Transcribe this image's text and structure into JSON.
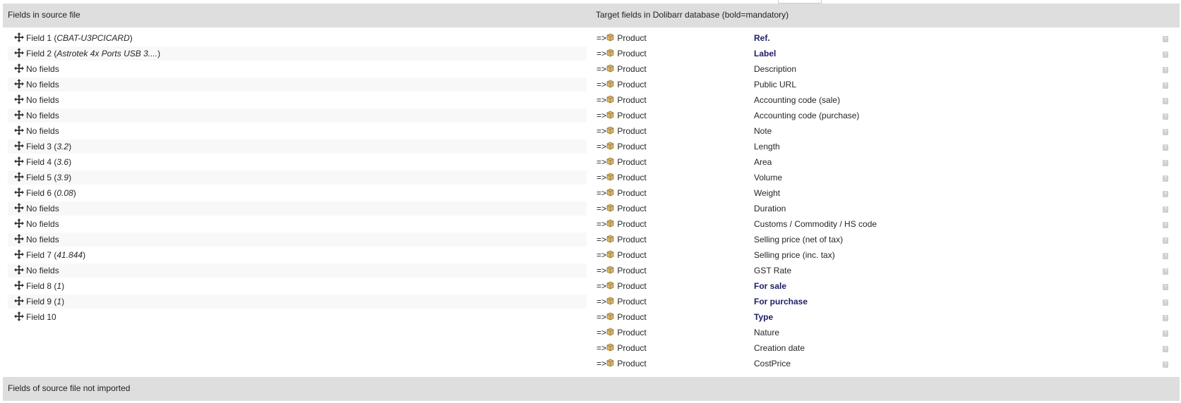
{
  "header": {
    "source_title": "Fields in source file",
    "target_title": "Target fields in Dolibarr database (bold=mandatory)"
  },
  "footer": {
    "not_imported_title": "Fields of source file not imported"
  },
  "arrow_text": "=>",
  "icons": {
    "move": "move-arrows-icon",
    "object": "package-icon",
    "help": "help-icon"
  },
  "colors": {
    "header_bg": "#dedede",
    "mandatory_text": "#1e1e66",
    "row_stripe": "#f8f8f8"
  },
  "source_fields": [
    {
      "label": "Field 1",
      "example": "CBAT-U3PCICARD"
    },
    {
      "label": "Field 2",
      "example": "Astrotek 4x Ports USB 3...."
    },
    {
      "label": "No fields",
      "example": ""
    },
    {
      "label": "No fields",
      "example": ""
    },
    {
      "label": "No fields",
      "example": ""
    },
    {
      "label": "No fields",
      "example": ""
    },
    {
      "label": "No fields",
      "example": ""
    },
    {
      "label": "Field 3",
      "example": "3.2"
    },
    {
      "label": "Field 4",
      "example": "3.6"
    },
    {
      "label": "Field 5",
      "example": "3.9"
    },
    {
      "label": "Field 6",
      "example": "0.08"
    },
    {
      "label": "No fields",
      "example": ""
    },
    {
      "label": "No fields",
      "example": ""
    },
    {
      "label": "No fields",
      "example": ""
    },
    {
      "label": "Field 7",
      "example": "41.844"
    },
    {
      "label": "No fields",
      "example": ""
    },
    {
      "label": "Field 8",
      "example": "1"
    },
    {
      "label": "Field 9",
      "example": "1"
    },
    {
      "label": "Field 10",
      "example": ""
    }
  ],
  "target_fields": [
    {
      "object": "Product",
      "label": "Ref.",
      "mandatory": true
    },
    {
      "object": "Product",
      "label": "Label",
      "mandatory": true
    },
    {
      "object": "Product",
      "label": "Description",
      "mandatory": false
    },
    {
      "object": "Product",
      "label": "Public URL",
      "mandatory": false
    },
    {
      "object": "Product",
      "label": "Accounting code (sale)",
      "mandatory": false
    },
    {
      "object": "Product",
      "label": "Accounting code (purchase)",
      "mandatory": false
    },
    {
      "object": "Product",
      "label": "Note",
      "mandatory": false
    },
    {
      "object": "Product",
      "label": "Length",
      "mandatory": false
    },
    {
      "object": "Product",
      "label": "Area",
      "mandatory": false
    },
    {
      "object": "Product",
      "label": "Volume",
      "mandatory": false
    },
    {
      "object": "Product",
      "label": "Weight",
      "mandatory": false
    },
    {
      "object": "Product",
      "label": "Duration",
      "mandatory": false
    },
    {
      "object": "Product",
      "label": "Customs / Commodity / HS code",
      "mandatory": false
    },
    {
      "object": "Product",
      "label": "Selling price (net of tax)",
      "mandatory": false
    },
    {
      "object": "Product",
      "label": "Selling price (inc. tax)",
      "mandatory": false
    },
    {
      "object": "Product",
      "label": "GST Rate",
      "mandatory": false
    },
    {
      "object": "Product",
      "label": "For sale",
      "mandatory": true
    },
    {
      "object": "Product",
      "label": "For purchase",
      "mandatory": true
    },
    {
      "object": "Product",
      "label": "Type",
      "mandatory": true
    },
    {
      "object": "Product",
      "label": "Nature",
      "mandatory": false
    },
    {
      "object": "Product",
      "label": "Creation date",
      "mandatory": false
    },
    {
      "object": "Product",
      "label": "CostPrice",
      "mandatory": false
    }
  ]
}
